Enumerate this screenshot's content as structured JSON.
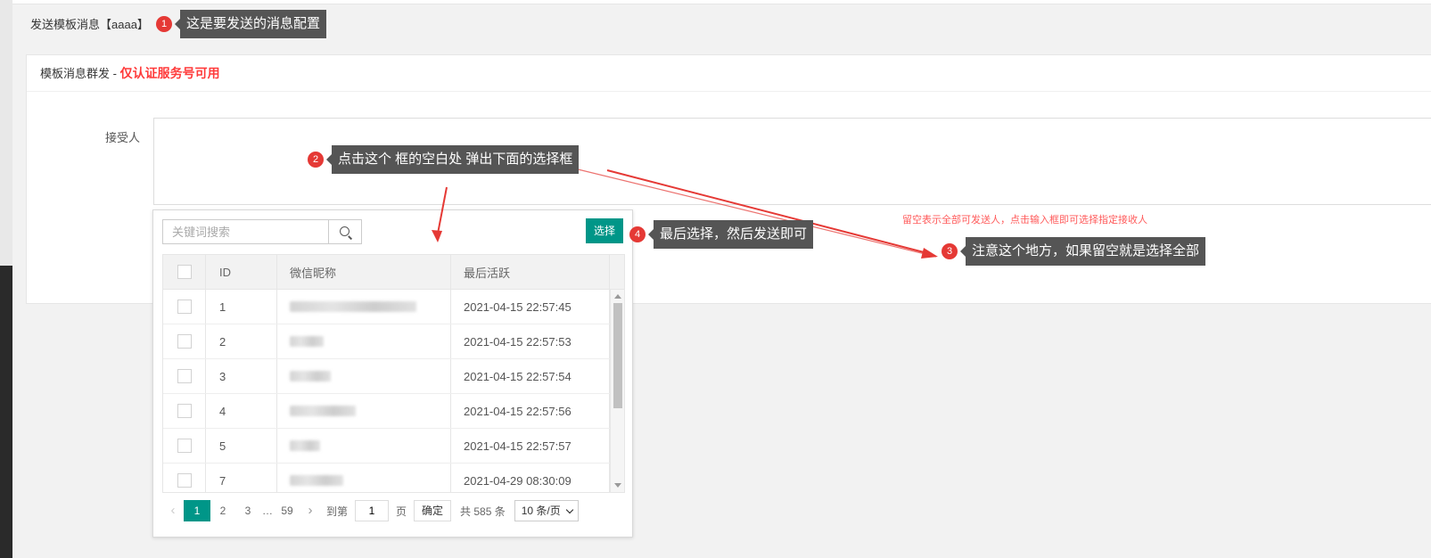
{
  "page": {
    "title": "发送模板消息【aaaa】"
  },
  "card": {
    "title": "模板消息群发",
    "separator": " - ",
    "warning": "仅认证服务号可用",
    "recipient_label": "接受人",
    "hint": "留空表示全部可发送人，点击输入框即可选择指定接收人"
  },
  "picker": {
    "search_placeholder": "关键词搜索",
    "select_label": "选择",
    "columns": {
      "id": "ID",
      "nickname": "微信昵称",
      "last_active": "最后活跃"
    },
    "rows": [
      {
        "id": "1",
        "last_active": "2021-04-15 22:57:45"
      },
      {
        "id": "2",
        "last_active": "2021-04-15 22:57:53"
      },
      {
        "id": "3",
        "last_active": "2021-04-15 22:57:54"
      },
      {
        "id": "4",
        "last_active": "2021-04-15 22:57:56"
      },
      {
        "id": "5",
        "last_active": "2021-04-15 22:57:57"
      },
      {
        "id": "7",
        "last_active": "2021-04-29 08:30:09"
      }
    ],
    "pager": {
      "pages": [
        "1",
        "2",
        "3"
      ],
      "ellipsis": "…",
      "last_page": "59",
      "goto_label": "到第",
      "goto_value": "1",
      "page_unit": "页",
      "confirm_label": "确定",
      "total": "共 585 条",
      "page_size": "10 条/页"
    }
  },
  "callouts": [
    {
      "num": "1",
      "text": "这是要发送的消息配置"
    },
    {
      "num": "2",
      "text": "点击这个 框的空白处 弹出下面的选择框"
    },
    {
      "num": "3",
      "text": "注意这个地方，如果留空就是选择全部"
    },
    {
      "num": "4",
      "text": "最后选择，然后发送即可"
    }
  ],
  "colors": {
    "accent": "#009688",
    "badge": "#e53935",
    "tooltip": "#555555",
    "warning": "#ff3b3b",
    "arrow": "#e53935"
  }
}
